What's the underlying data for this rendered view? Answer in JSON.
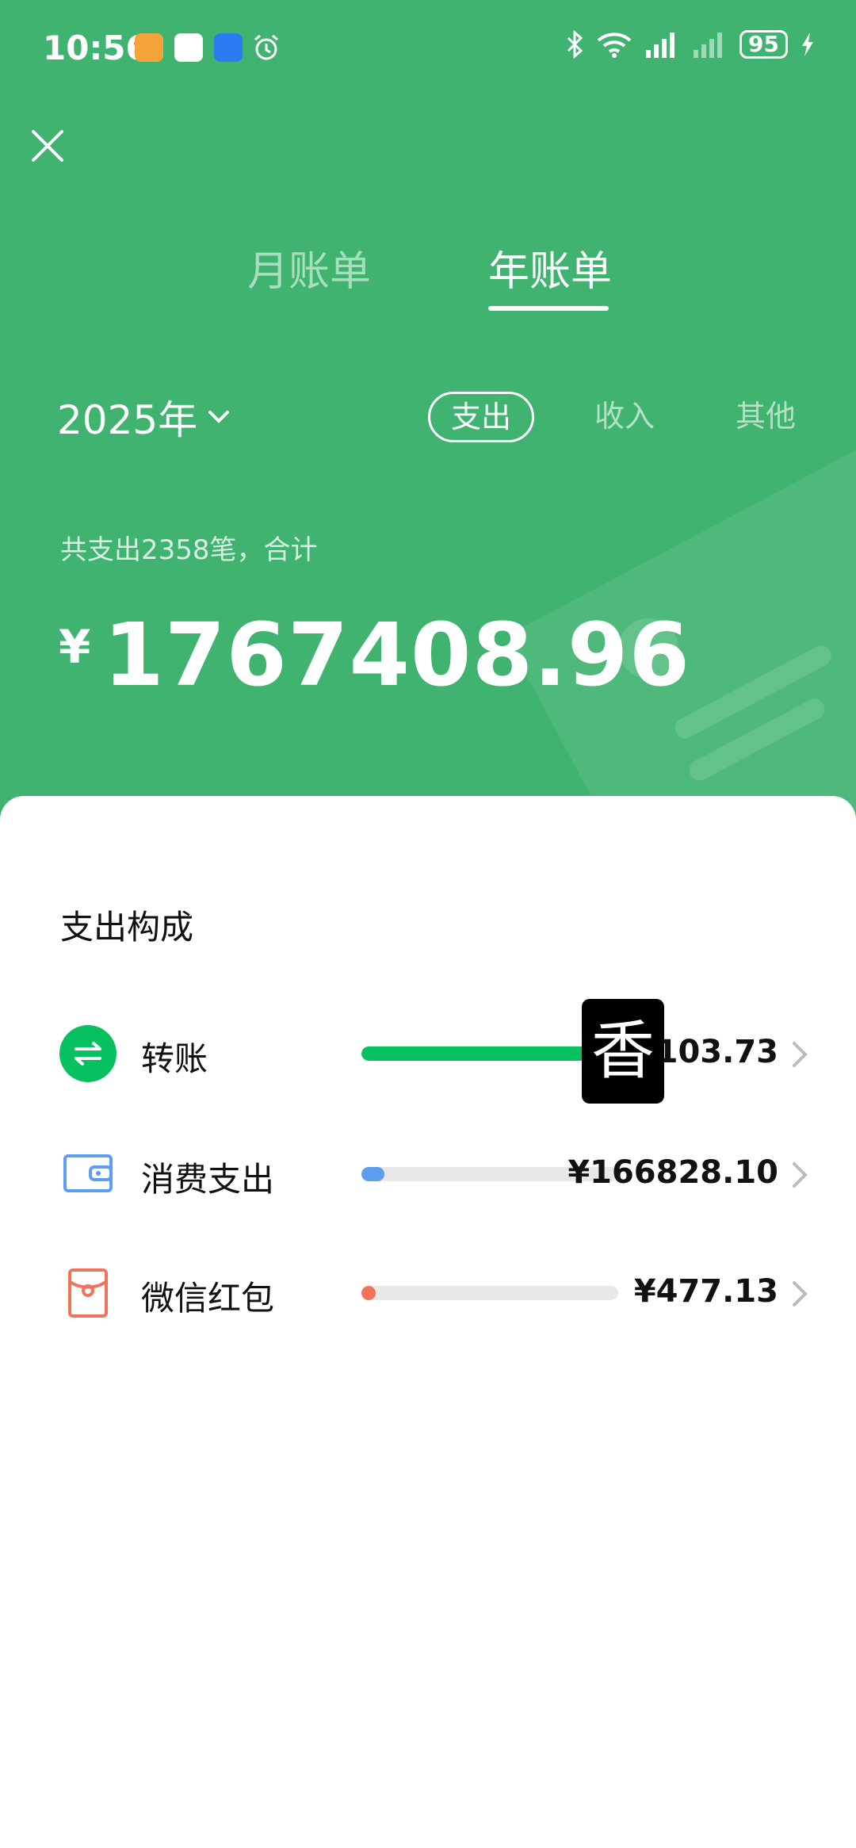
{
  "status_bar": {
    "time": "10:56",
    "battery": "95"
  },
  "tabs": [
    {
      "label": "月账单",
      "active": false
    },
    {
      "label": "年账单",
      "active": true
    }
  ],
  "year_selector": "2025年",
  "filters": [
    {
      "label": "支出",
      "active": true
    },
    {
      "label": "收入",
      "active": false
    },
    {
      "label": "其他",
      "active": false
    }
  ],
  "summary": {
    "count_text": "共支出2358笔，合计",
    "currency": "¥",
    "total": "1767408.96"
  },
  "composition": {
    "title": "支出构成",
    "items": [
      {
        "label": "转账",
        "amount": "0103.73",
        "fraction": 0.9,
        "color": "#07c160",
        "icon": "transfer-icon"
      },
      {
        "label": "消费支出",
        "amount": "¥166828.10",
        "fraction": 0.09,
        "color": "#5b9ef2",
        "icon": "wallet-icon"
      },
      {
        "label": "微信红包",
        "amount": "¥477.13",
        "fraction": 0.02,
        "color": "#f0735a",
        "icon": "red-packet-icon"
      }
    ]
  },
  "overlay_glyph": "香",
  "colors": {
    "header_green": "#3fb36f",
    "accent_green": "#07c160"
  }
}
